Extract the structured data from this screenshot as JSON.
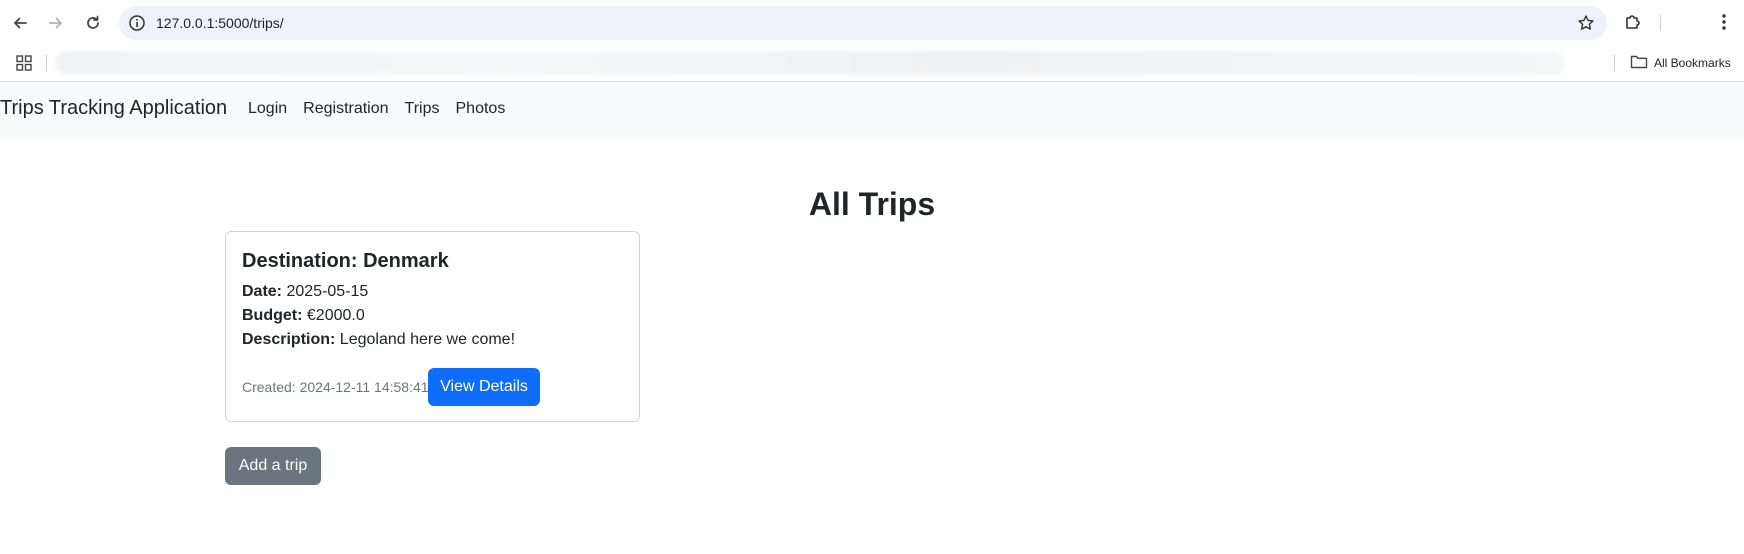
{
  "browser": {
    "url": "127.0.0.1:5000/trips/",
    "bookmarks_label": "All Bookmarks"
  },
  "navbar": {
    "brand": "Trips Tracking Application",
    "links": [
      "Login",
      "Registration",
      "Trips",
      "Photos"
    ]
  },
  "main": {
    "title": "All Trips",
    "trip": {
      "destination_label": "Destination: Denmark",
      "date_label": "Date:",
      "date_value": "2025-05-15",
      "budget_label": "Budget:",
      "budget_value": "€2000.0",
      "description_label": "Description:",
      "description_value": "Legoland here we come!",
      "created_text": "Created: 2024-12-11 14:58:41",
      "view_button": "View Details"
    },
    "add_button": "Add a trip"
  },
  "colors": {
    "primary": "#0d6efd",
    "secondary": "#6c757d",
    "navbar_bg": "#f8f9fa",
    "omnibox_bg": "#eef1f8"
  },
  "icons": [
    "back-arrow-icon",
    "forward-arrow-icon",
    "reload-icon",
    "site-info-icon",
    "bookmark-star-icon",
    "extensions-icon",
    "kebab-menu-icon",
    "apps-grid-icon",
    "folder-icon"
  ]
}
